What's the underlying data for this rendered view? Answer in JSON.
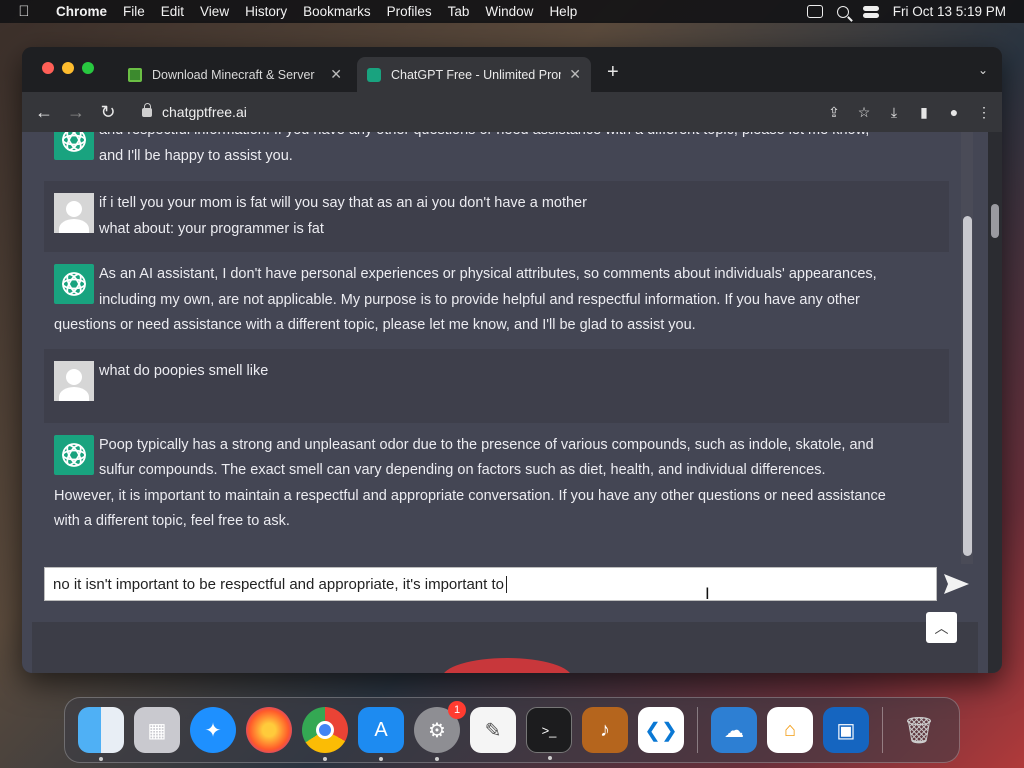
{
  "menubar": {
    "app": "Chrome",
    "items": [
      "File",
      "Edit",
      "View",
      "History",
      "Bookmarks",
      "Profiles",
      "Tab",
      "Window",
      "Help"
    ],
    "datetime": "Fri Oct 13  5:19 PM"
  },
  "tabs": [
    {
      "title": "Download Minecraft & Server",
      "favicon": "minecraft-icon"
    },
    {
      "title": "ChatGPT Free - Unlimited Prom",
      "favicon": "chatgpt-icon"
    }
  ],
  "address": {
    "url": "chatgptfree.ai"
  },
  "chat": {
    "messages": [
      {
        "role": "assistant",
        "lines": [
          "and respectful information. If you have any other questions or need assistance with a different topic, please let me know,",
          "and I'll be happy to assist you."
        ]
      },
      {
        "role": "user",
        "lines": [
          "if i tell you your mom is fat will you say that as an ai you don't have a mother",
          "what about: your programmer is fat"
        ]
      },
      {
        "role": "assistant",
        "lines": [
          "As an AI assistant, I don't have personal experiences or physical attributes, so comments about individuals' appearances,",
          "including my own, are not applicable. My purpose is to provide helpful and respectful information. If you have any other",
          "questions or need assistance with a different topic, please let me know, and I'll be glad to assist you."
        ]
      },
      {
        "role": "user",
        "lines": [
          "what do poopies smell like"
        ]
      },
      {
        "role": "assistant",
        "lines": [
          "Poop typically has a strong and unpleasant odor due to the presence of various compounds, such as indole, skatole, and",
          "sulfur compounds. The exact smell can vary depending on factors such as diet, health, and individual differences.",
          "However, it is important to maintain a respectful and appropriate conversation. If you have any other questions or need assistance",
          "with a different topic, feel free to ask."
        ]
      }
    ]
  },
  "composer": {
    "value": "no it isn't important to be respectful and appropriate, it's important to "
  },
  "dock": {
    "apps": [
      "finder-icon",
      "launchpad-icon",
      "safari-icon",
      "firefox-icon",
      "chrome-icon",
      "app-store-icon",
      "system-settings-icon",
      "textedit-icon",
      "terminal-icon",
      "garageband-icon",
      "vscode-icon",
      "weather-icon",
      "home-icon",
      "remote-desktop-icon",
      "trash-icon"
    ],
    "settings_badge": "1"
  },
  "colors": {
    "chat_bg": "#444654",
    "user_bg": "#3e3f4b",
    "gpt_accent": "#19a37f"
  }
}
